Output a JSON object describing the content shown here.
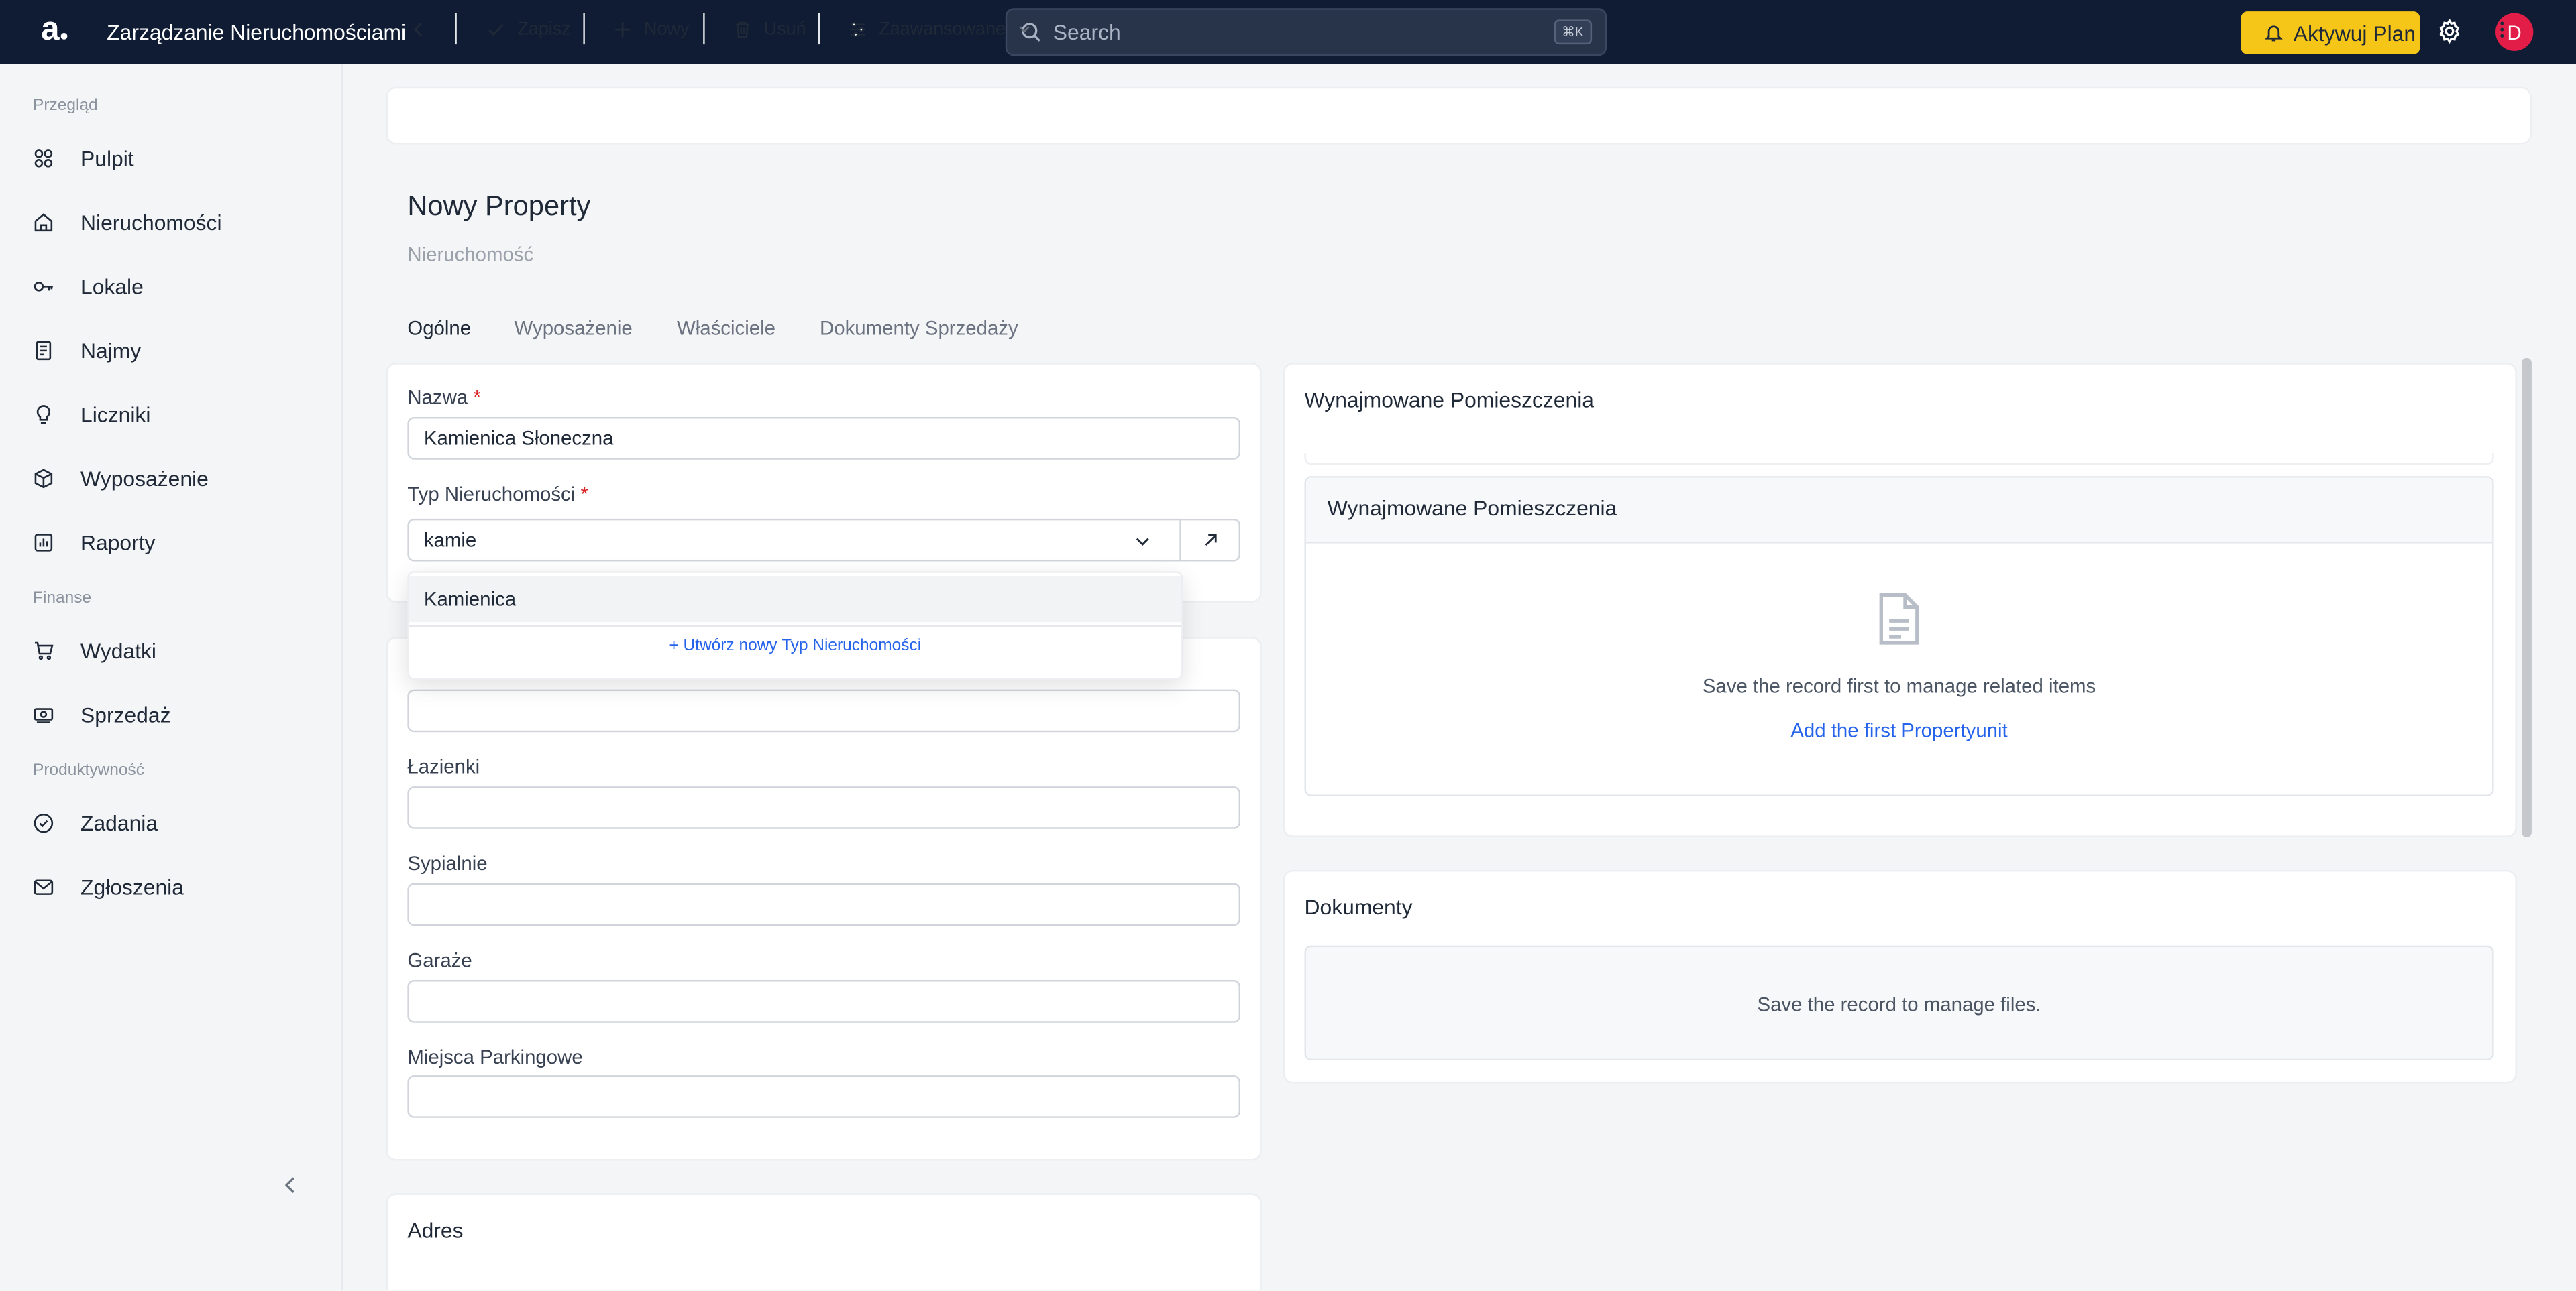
{
  "app": {
    "logo": "a",
    "title": "Zarządzanie Nieruchomościami"
  },
  "search": {
    "placeholder": "Search",
    "shortcut": "⌘K"
  },
  "header": {
    "upgrade_label": "Aktywuj Plan",
    "avatar_initial": "D"
  },
  "sidebar": {
    "sections": [
      {
        "label": "Przegląd",
        "items": [
          {
            "label": "Pulpit",
            "icon": "grid-icon"
          },
          {
            "label": "Nieruchomości",
            "icon": "building-icon"
          },
          {
            "label": "Lokale",
            "icon": "key-icon"
          },
          {
            "label": "Najmy",
            "icon": "document-icon"
          },
          {
            "label": "Liczniki",
            "icon": "lightbulb-icon"
          },
          {
            "label": "Wyposażenie",
            "icon": "box-icon"
          },
          {
            "label": "Raporty",
            "icon": "report-icon"
          }
        ]
      },
      {
        "label": "Finanse",
        "items": [
          {
            "label": "Wydatki",
            "icon": "cart-icon"
          },
          {
            "label": "Sprzedaż",
            "icon": "cash-icon"
          }
        ]
      },
      {
        "label": "Produktywność",
        "items": [
          {
            "label": "Zadania",
            "icon": "check-circle-icon"
          },
          {
            "label": "Zgłoszenia",
            "icon": "mail-icon"
          }
        ]
      }
    ]
  },
  "toolbar": {
    "save_label": "Zapisz",
    "new_label": "Nowy",
    "delete_label": "Usuń",
    "advanced_label": "Zaawansowane"
  },
  "page": {
    "title": "Nowy Property",
    "subtitle": "Nieruchomość"
  },
  "tabs": [
    {
      "label": "Ogólne",
      "active": true
    },
    {
      "label": "Wyposażenie",
      "active": false
    },
    {
      "label": "Właściciele",
      "active": false
    },
    {
      "label": "Dokumenty Sprzedaży",
      "active": false
    }
  ],
  "form": {
    "name_label": "Nazwa",
    "name_value": "Kamienica Słoneczna",
    "type_label": "Typ Nieruchomości",
    "type_query": "kamie",
    "dropdown_option": "Kamienica",
    "dropdown_create": "+ Utwórz nowy Typ Nieruchomości",
    "bathrooms_label": "Łazienki",
    "bedrooms_label": "Sypialnie",
    "garages_label": "Garaże",
    "parking_label": "Miejsca Parkingowe",
    "address_title": "Adres"
  },
  "units_panel": {
    "title": "Wynajmowane Pomieszczenia",
    "inner_title": "Wynajmowane Pomieszczenia",
    "empty_text": "Save the record first to manage related items",
    "add_link": "Add the first Propertyunit"
  },
  "documents_panel": {
    "title": "Dokumenty",
    "empty_text": "Save the record to manage files."
  },
  "colors": {
    "topbar": "#0f1c33",
    "accent": "#f5c518",
    "link": "#2563eb",
    "required": "#dc2626",
    "avatar": "#e11d48"
  }
}
